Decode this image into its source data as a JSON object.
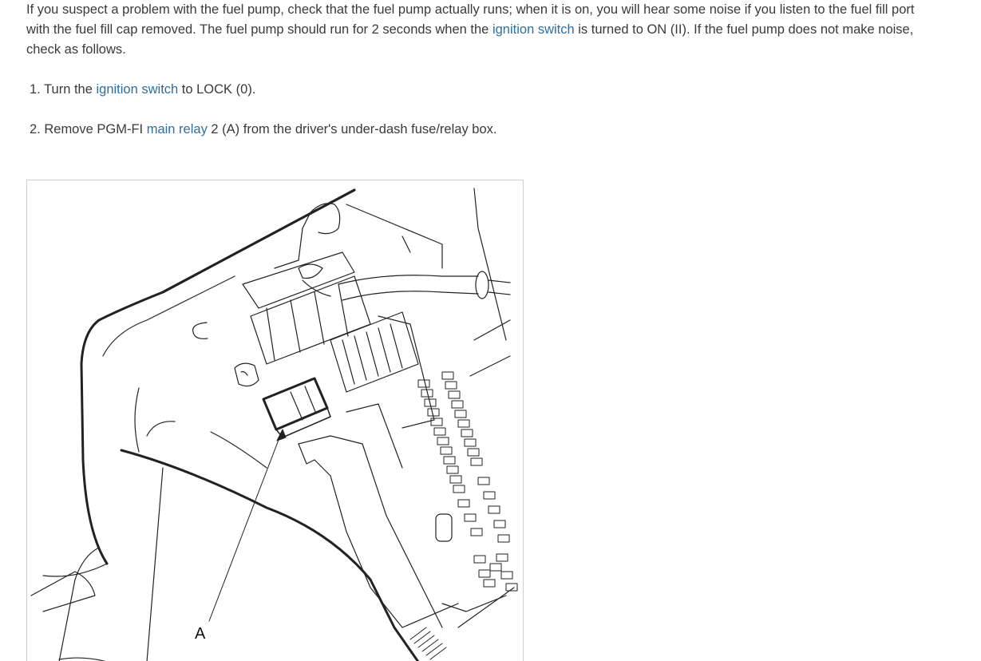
{
  "intro": {
    "line1": "If you suspect a problem with the fuel pump, check that the fuel pump actually runs; when it is on, you will hear some noise if you listen to the fuel fill port",
    "line2_a": "with the fuel fill cap removed. The fuel pump should run for 2 seconds when the ",
    "line2_link": "ignition switch",
    "line2_b": " is turned to ON (II). If the fuel pump does not make noise,",
    "line3": "check as follows."
  },
  "steps": [
    {
      "number": "1.",
      "text_a": " Turn the ",
      "link": "ignition switch",
      "text_b": " to LOCK (0)."
    },
    {
      "number": "2.",
      "text_a": " Remove PGM-FI ",
      "link": "main relay",
      "text_b": " 2 (A) from the driver's under-dash fuse/relay box."
    }
  ],
  "figure": {
    "callout_label": "A"
  },
  "colors": {
    "text": "#3a3a3a",
    "link": "#2f6f9e",
    "figure_border": "#cfcfcf"
  }
}
